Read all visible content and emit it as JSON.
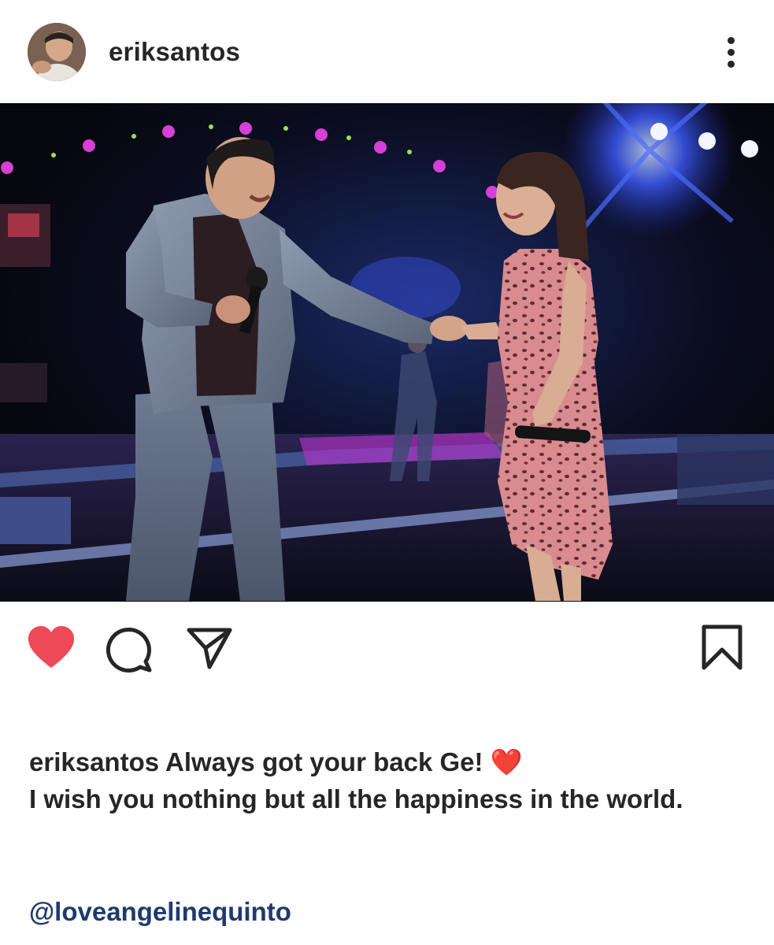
{
  "header": {
    "username": "eriksantos",
    "avatar_icon": "profile-photo",
    "more_icon": "more-vertical-icon"
  },
  "photo": {
    "description_icon": "post-photo"
  },
  "actions": {
    "like_icon": "heart-filled-icon",
    "like_color": "#ed4956",
    "comment_icon": "comment-icon",
    "share_icon": "paper-plane-icon",
    "save_icon": "bookmark-icon"
  },
  "caption": {
    "username": "eriksantos",
    "text_line1": "Always got your back Ge!",
    "emoji": "❤️",
    "text_rest": "I wish you nothing but all the happiness in the world.",
    "mention": "@loveangelinequinto"
  },
  "colors": {
    "text": "#262626",
    "link": "#1f3a6e",
    "like": "#ed4956"
  }
}
